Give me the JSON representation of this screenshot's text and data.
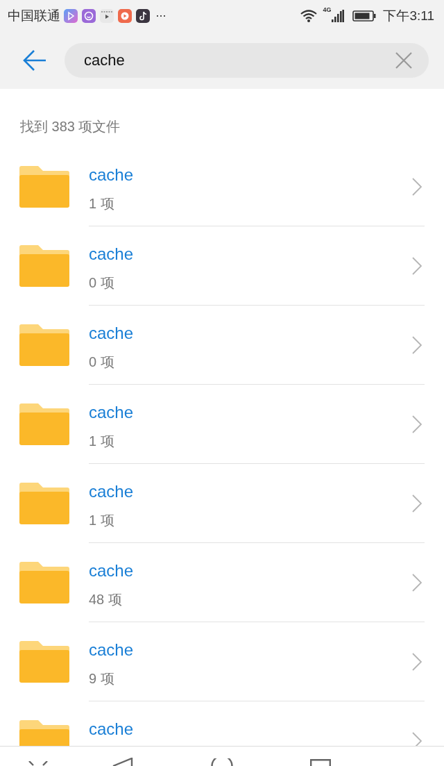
{
  "status_bar": {
    "carrier": "中国联通",
    "more_indicator": "···",
    "network_type": "4G",
    "time": "下午3:11"
  },
  "search": {
    "value": "cache"
  },
  "result_summary": "找到 383 项文件",
  "results": [
    {
      "name": "cache",
      "count": "1 项"
    },
    {
      "name": "cache",
      "count": "0 项"
    },
    {
      "name": "cache",
      "count": "0 项"
    },
    {
      "name": "cache",
      "count": "1 项"
    },
    {
      "name": "cache",
      "count": "1 项"
    },
    {
      "name": "cache",
      "count": "48 项"
    },
    {
      "name": "cache",
      "count": "9 项"
    },
    {
      "name": "cache"
    }
  ]
}
